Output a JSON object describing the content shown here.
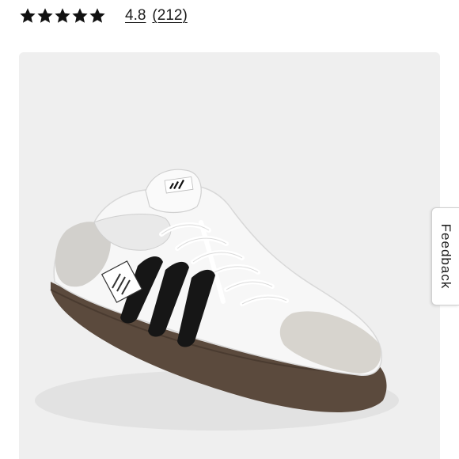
{
  "rating": {
    "stars_filled": 5,
    "stars_total": 5,
    "value": "4.8",
    "count": "(212)"
  },
  "product_image": {
    "brand_tag": "adidas",
    "icon": "sneaker-photo"
  },
  "feedback": {
    "label": "Feedback"
  },
  "colors": {
    "star": "#111111",
    "panel_bg": "#efefef",
    "sole": "#5b4a3d"
  }
}
